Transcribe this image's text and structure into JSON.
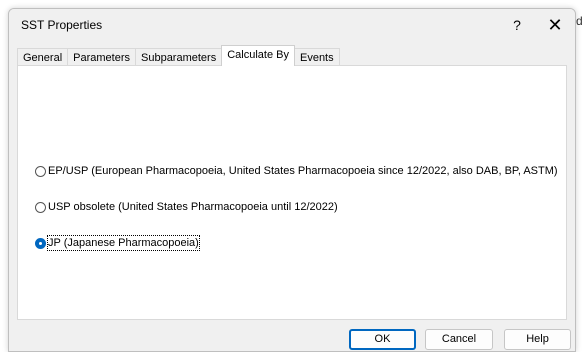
{
  "dialog": {
    "title": "SST Properties",
    "help_glyph": "?",
    "close_glyph": "✕"
  },
  "backdrop": {
    "glyph": "d"
  },
  "tabs": [
    {
      "label": "General",
      "active": false
    },
    {
      "label": "Parameters",
      "active": false
    },
    {
      "label": "Subparameters",
      "active": false
    },
    {
      "label": "Calculate By",
      "active": true
    },
    {
      "label": "Events",
      "active": false
    }
  ],
  "options": [
    {
      "label": "EP/USP (European Pharmacopoeia, United States Pharmacopoeia since 12/2022, also DAB, BP, ASTM)",
      "checked": false
    },
    {
      "label": "USP obsolete (United States Pharmacopoeia until 12/2022)",
      "checked": false
    },
    {
      "label": "JP (Japanese Pharmacopoeia)",
      "checked": true
    }
  ],
  "buttons": {
    "ok": "OK",
    "cancel": "Cancel",
    "help": "Help"
  },
  "colors": {
    "accent": "#0067c0",
    "dialog_bg": "#f0f0f0",
    "panel_bg": "#ffffff"
  }
}
